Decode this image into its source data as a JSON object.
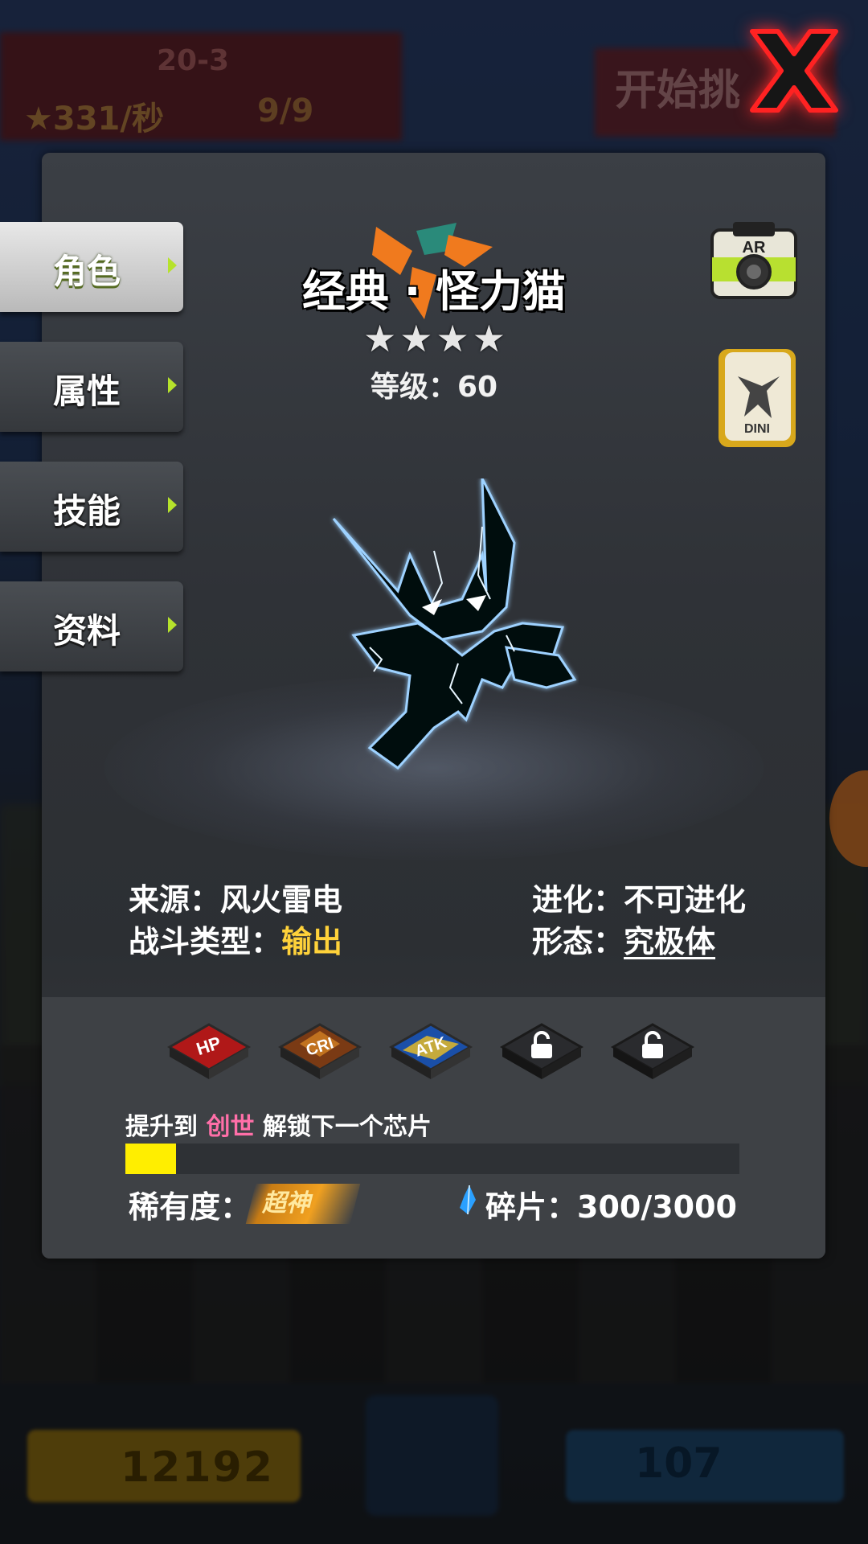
{
  "background": {
    "level": "20-3",
    "stars_rate": "331/秒",
    "pets": "9/9",
    "start_button": "开始挑",
    "coins": "12192",
    "gems": "107"
  },
  "tabs": [
    {
      "label": "角色",
      "active": true
    },
    {
      "label": "属性",
      "active": false
    },
    {
      "label": "技能",
      "active": false
    },
    {
      "label": "资料",
      "active": false
    }
  ],
  "character": {
    "name": "经典 · 怪力猫",
    "stars": 4,
    "level_label": "等级：60"
  },
  "ar_button": {
    "badge": "AR"
  },
  "info": {
    "source_label": "来源：",
    "source_value": "风火雷电",
    "evolution_label": "进化：",
    "evolution_value": "不可进化",
    "combat_type_label": "战斗类型：",
    "combat_type_value": "输出",
    "form_label": "形态：",
    "form_value": "究极体"
  },
  "chips": [
    {
      "icon": "hp-chip-icon",
      "text": "HP"
    },
    {
      "icon": "cri-chip-icon",
      "text": "CRI"
    },
    {
      "icon": "atk-chip-icon",
      "text": "ATK"
    },
    {
      "icon": "lock-icon",
      "text": ""
    },
    {
      "icon": "lock-icon",
      "text": ""
    }
  ],
  "unlock": {
    "prefix": "提升到",
    "highlight": "创世",
    "suffix": "解锁下一个芯片",
    "progress": 0.083
  },
  "rarity": {
    "label": "稀有度：",
    "value": "超神"
  },
  "shards": {
    "label": "碎片：",
    "value": "300/3000"
  },
  "colors": {
    "accent": "#b6e22c",
    "highlight": "#ffd23a",
    "progress": "#ffee00",
    "unlock_highlight": "#ff6fa8"
  }
}
